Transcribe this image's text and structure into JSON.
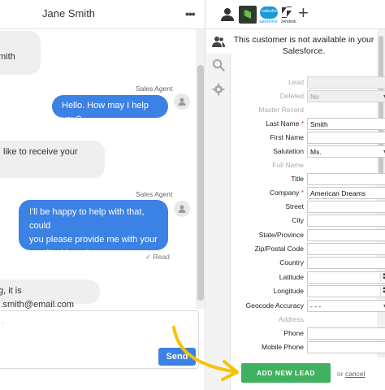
{
  "chat": {
    "title": "Jane Smith",
    "more_icon": "more-horizontal-icon",
    "messages": [
      {
        "from": "customer",
        "text": "mith"
      },
      {
        "from": "agent",
        "sender": "Sales Agent",
        "text": "Hello. How may I help you?"
      },
      {
        "from": "customer",
        "line1": "like to receive your",
        "line2": ""
      },
      {
        "from": "agent",
        "sender": "Sales Agent",
        "line1": "I'll be happy to help with that, could",
        "line2": "you please provide me with your",
        "line3": "email address?",
        "status": "✓ Read"
      },
      {
        "from": "customer",
        "text": "g, it is j.smith@email.com"
      }
    ],
    "composer_placeholder": ".",
    "send_label": "Send"
  },
  "topbar": {
    "tabs": [
      "person-icon",
      "active-app-icon",
      "salesforce-icon",
      "zendesk-icon",
      "plus-icon"
    ],
    "salesforce_text": "salesforce",
    "zendesk_text": "zendesk",
    "plus": "+"
  },
  "sidenav": [
    "people-icon",
    "search-icon",
    "gear-icon"
  ],
  "salesforce": {
    "message": "This customer is not available in your Salesforce.",
    "message_line1": "This customer is not available in your",
    "message_line2": "Salesforce.",
    "fields": [
      {
        "label": "Lead",
        "value": "",
        "disabled": true,
        "input": "disabled"
      },
      {
        "label": "Deleted",
        "value": "No",
        "disabled": true,
        "input": "disabled-select"
      },
      {
        "label": "Master Record",
        "value": "",
        "disabled": true,
        "input": "none"
      },
      {
        "label": "Last Name",
        "value": "Smith",
        "required": true,
        "input": "text"
      },
      {
        "label": "First Name",
        "value": "",
        "input": "text"
      },
      {
        "label": "Salutation",
        "value": "Ms.",
        "input": "select"
      },
      {
        "label": "Full Name",
        "value": "",
        "disabled": true,
        "input": "none"
      },
      {
        "label": "Title",
        "value": "",
        "input": "text"
      },
      {
        "label": "Company",
        "value": "American Dreams",
        "required": true,
        "input": "text"
      },
      {
        "label": "Street",
        "value": "",
        "input": "text"
      },
      {
        "label": "City",
        "value": "",
        "input": "text"
      },
      {
        "label": "State/Province",
        "value": "",
        "input": "text"
      },
      {
        "label": "Zip/Postal Code",
        "value": "",
        "input": "text"
      },
      {
        "label": "Country",
        "value": "",
        "input": "text"
      },
      {
        "label": "Latitude",
        "value": "",
        "input": "number"
      },
      {
        "label": "Longitude",
        "value": "",
        "input": "number"
      },
      {
        "label": "Geocode Accuracy",
        "value": "- - -",
        "input": "select"
      },
      {
        "label": "Address",
        "value": "",
        "disabled": true,
        "input": "none"
      },
      {
        "label": "Phone",
        "value": "",
        "input": "text"
      },
      {
        "label": "Mobile Phone",
        "value": "",
        "input": "text"
      }
    ],
    "add_button": "ADD NEW LEAD",
    "or_text": "or",
    "cancel_text": "cancel",
    "required_mark": "*"
  },
  "colors": {
    "agent_bubble": "#3b82e4",
    "customer_bubble": "#efefef",
    "add_button": "#3fb15f",
    "salesforce": "#1a9ad6",
    "arrow": "#f5c400"
  }
}
